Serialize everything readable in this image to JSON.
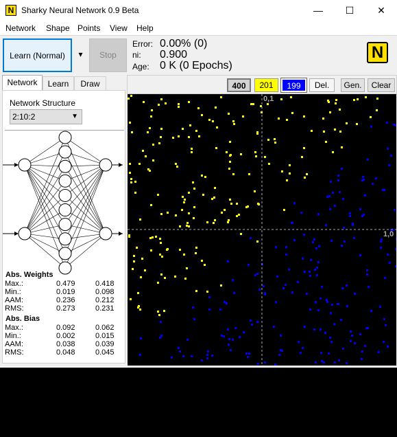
{
  "window": {
    "title": "Sharky Neural Network 0.9 Beta",
    "icon_letter": "N",
    "minimize": "—",
    "maximize": "☐",
    "close": "✕"
  },
  "menu": [
    "Network",
    "Shape",
    "Points",
    "View",
    "Help"
  ],
  "toolbar": {
    "learn_label": "Learn (Normal)",
    "dropdown": "▾",
    "stop_label": "Stop",
    "error_label": "Error:",
    "error_value": "0.00% (0)",
    "ni_label": "ni:",
    "ni_value": "0.900",
    "age_label": "Age:",
    "age_value": "0 K (0 Epochs)",
    "logo_letter": "N"
  },
  "tabs": [
    "Network",
    "Learn",
    "Draw"
  ],
  "network": {
    "structure_label": "Network Structure",
    "structure_value": "2:10:2"
  },
  "weights": {
    "heading": "Abs. Weights",
    "rows": [
      {
        "label": "Max.:",
        "a": "0.479",
        "b": "0.418"
      },
      {
        "label": "Min.:",
        "a": "0.019",
        "b": "0.098"
      },
      {
        "label": "AAM:",
        "a": "0.236",
        "b": "0.212"
      },
      {
        "label": "RMS:",
        "a": "0.273",
        "b": "0.231"
      }
    ]
  },
  "bias": {
    "heading": "Abs. Bias",
    "rows": [
      {
        "label": "Max.:",
        "a": "0.092",
        "b": "0.062"
      },
      {
        "label": "Min.:",
        "a": "0.002",
        "b": "0.015"
      },
      {
        "label": "AAM:",
        "a": "0.038",
        "b": "0.039"
      },
      {
        "label": "RMS:",
        "a": "0.048",
        "b": "0.045"
      }
    ]
  },
  "points_bar": {
    "total": "400",
    "yellow_count": "201",
    "blue_count": "199",
    "del": "Del.",
    "gen": "Gen.",
    "clear": "Clear"
  },
  "plot": {
    "y_axis_label": "0,1",
    "x_axis_label": "1,0",
    "colors": {
      "yellow": "#ffff00",
      "blue": "#0000ff",
      "background": "#000000",
      "axis": "#aaaaaa"
    }
  }
}
